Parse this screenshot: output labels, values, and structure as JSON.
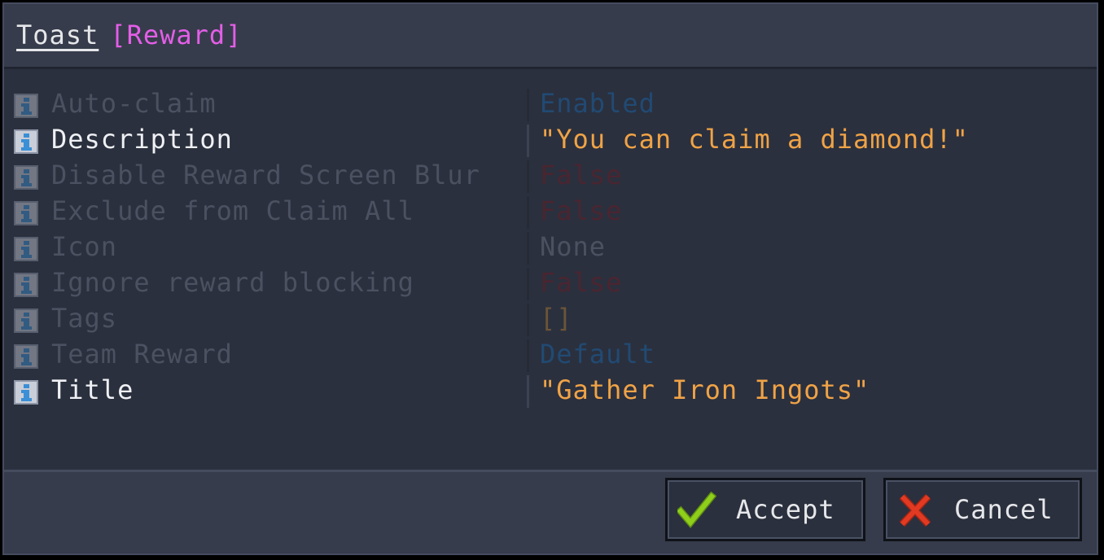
{
  "header": {
    "title": "Toast",
    "type_label": "[Reward]"
  },
  "properties": [
    {
      "name": "Auto-claim",
      "value": "Enabled",
      "value_color": "#214a73",
      "dim": true
    },
    {
      "name": "Description",
      "value": "\"You can claim a diamond!\"",
      "value_color": "#f0a346",
      "dim": false
    },
    {
      "name": "Disable Reward Screen Blur",
      "value": "False",
      "value_color": "#4a2530",
      "dim": true
    },
    {
      "name": "Exclude from Claim All",
      "value": "False",
      "value_color": "#4a2530",
      "dim": true
    },
    {
      "name": "Icon",
      "value": "None",
      "value_color": "#4b5160",
      "dim": true
    },
    {
      "name": "Ignore reward blocking",
      "value": "False",
      "value_color": "#4a2530",
      "dim": true
    },
    {
      "name": "Tags",
      "value": "[]",
      "value_color": "#6b5538",
      "dim": true
    },
    {
      "name": "Team Reward",
      "value": "Default",
      "value_color": "#214a73",
      "dim": true
    },
    {
      "name": "Title",
      "value": "\"Gather Iron Ingots\"",
      "value_color": "#f0a346",
      "dim": false
    }
  ],
  "footer": {
    "accept_label": "Accept",
    "cancel_label": "Cancel"
  },
  "colors": {
    "accent_type": "#e45ee8",
    "string_value": "#f0a346",
    "check_green": "#8fce1a",
    "cross_red": "#e23a22"
  },
  "icons": {
    "property": "info-icon",
    "accept": "checkmark-icon",
    "cancel": "cross-icon"
  }
}
